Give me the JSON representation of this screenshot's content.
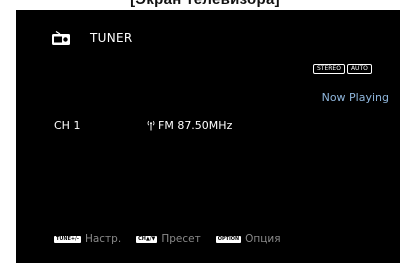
{
  "caption": "[Экран телевизора]",
  "header": {
    "icon": "tuner-icon",
    "source": "TUNER"
  },
  "badges": [
    "STEREO",
    "AUTO"
  ],
  "status": {
    "now_playing": "Now Playing"
  },
  "station": {
    "channel": "CH 1",
    "antenna_icon": "antenna-icon",
    "frequency": "FM 87.50MHz"
  },
  "footer": {
    "hints": [
      {
        "key": "TUNE+/-",
        "label": "Настр."
      },
      {
        "key": "CH▲/▼",
        "label": "Пресет"
      },
      {
        "key": "OPTION",
        "label": "Опция"
      }
    ]
  },
  "colors": {
    "screen_bg": "#000000",
    "accent_text": "#8fb6dc",
    "hint_text": "#8a8a8a"
  }
}
